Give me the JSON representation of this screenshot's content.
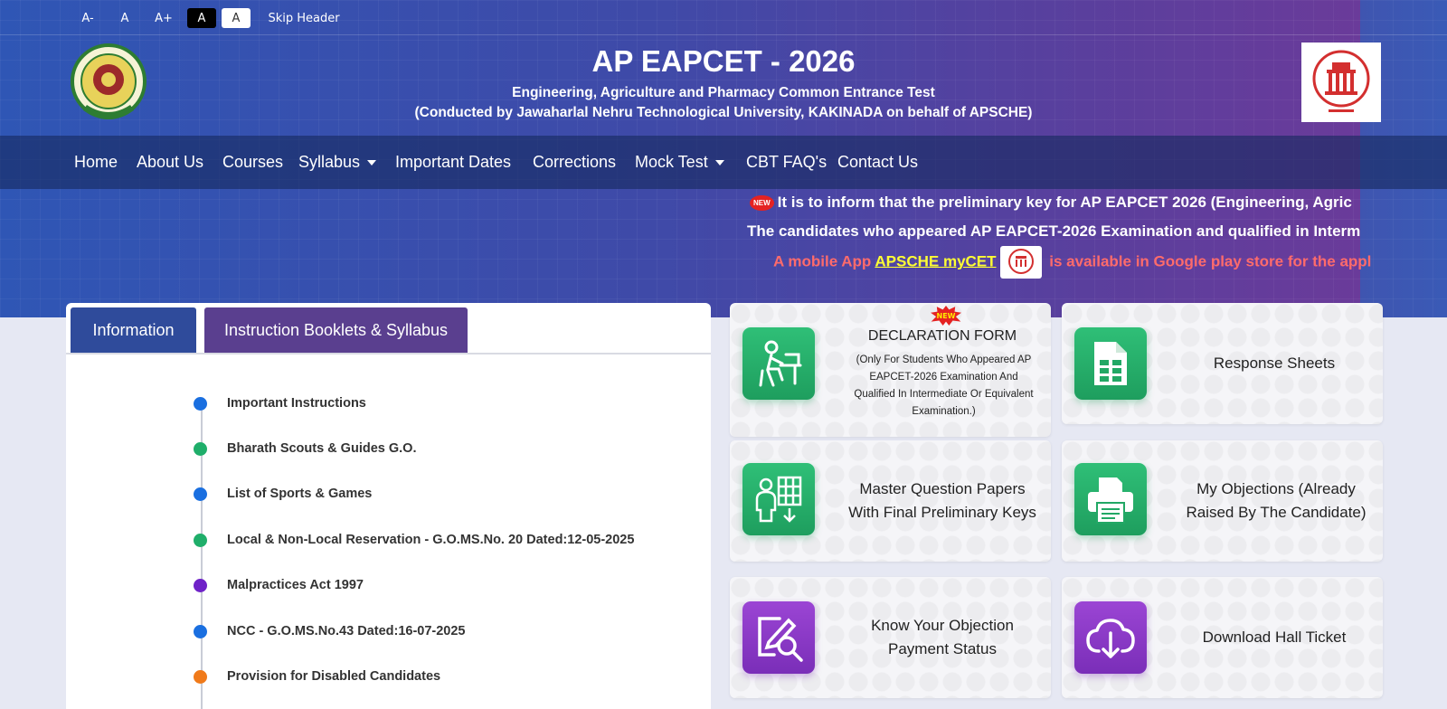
{
  "accessibility": {
    "font_decrease": "A-",
    "font_normal": "A",
    "font_increase": "A+",
    "contrast_dark": "A",
    "contrast_light": "A",
    "skip_header": "Skip Header"
  },
  "header": {
    "title": "AP EAPCET - 2026",
    "subtitle": "Engineering, Agriculture and Pharmacy Common Entrance Test",
    "conducted_by": "(Conducted by Jawaharlal Nehru Technological University, KAKINADA on behalf of APSCHE)"
  },
  "nav": {
    "home": "Home",
    "about": "About Us",
    "courses": "Courses",
    "syllabus": "Syllabus",
    "important_dates": "Important Dates",
    "corrections": "Corrections",
    "mock_test": "Mock Test",
    "cbt_faqs": "CBT FAQ's",
    "contact": "Contact Us"
  },
  "marquee": {
    "new_badge": "NEW",
    "line1": "It is to inform that the preliminary key for AP EAPCET 2026 (Engineering, Agric",
    "line2": "The candidates who appeared AP EAPCET-2026 Examination and qualified in Interm",
    "line3_prefix": "A mobile App ",
    "line3_link": "APSCHE myCET",
    "line3_suffix": " is available in Google play store for the appl"
  },
  "info_panel": {
    "tab_info": "Information",
    "tab_booklets": "Instruction Booklets & Syllabus",
    "items": [
      {
        "label": "Important Instructions",
        "color": "#1a6fe0"
      },
      {
        "label": "Bharath Scouts & Guides G.O.",
        "color": "#1fae6a"
      },
      {
        "label": "List of Sports & Games",
        "color": "#1a6fe0"
      },
      {
        "label": "Local & Non-Local Reservation - G.O.MS.No. 20 Dated:12-05-2025",
        "color": "#1fae6a"
      },
      {
        "label": "Malpractices Act 1997",
        "color": "#6f22c8"
      },
      {
        "label": "NCC - G.O.MS.No.43 Dated:16-07-2025",
        "color": "#1a6fe0"
      },
      {
        "label": "Provision for Disabled Candidates",
        "color": "#f07a1a"
      }
    ]
  },
  "cards": {
    "declaration_new": "NEW",
    "declaration_title": "DECLARATION FORM",
    "declaration_note": "(Only For Students Who Appeared AP EAPCET-2026 Examination And Qualified In Intermediate Or Equivalent Examination.)",
    "response_sheets": "Response Sheets",
    "master_papers": "Master Question Papers With Final Preliminary Keys",
    "my_objections": "My Objections (Already Raised By The Candidate)",
    "objection_payment": "Know Your Objection Payment Status",
    "hall_ticket": "Download Hall Ticket"
  },
  "colors": {
    "nav_bg": "#1c3266",
    "tab_info": "#2f4b9b",
    "tab_booklets": "#5a3f8f",
    "green_icon": "#22a865",
    "purple_icon": "#8a38c8",
    "marquee_red": "#ff6b6b",
    "link_yellow": "#ffff33"
  }
}
